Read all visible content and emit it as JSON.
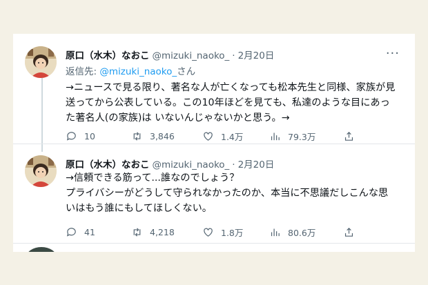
{
  "tweets": [
    {
      "name": "原口（水木）なおこ",
      "handle": "@mizuki_naoko_",
      "separator": "·",
      "date": "2月20日",
      "reply_to": {
        "prefix": "返信先: ",
        "mention": "@mizuki_naoko_",
        "suffix": "さん"
      },
      "lines": [
        "→ニュースで見る限り、著名な人が亡くなっても松本先生と同様、家族が見",
        "送ってから公表している。この10年ほどを見ても、私達のような目にあっ",
        "た著名人(の家族)は いないんじゃないかと思う。→"
      ],
      "stats": {
        "replies": "10",
        "retweets": "3,846",
        "likes": "1.4万",
        "views": "79.3万"
      }
    },
    {
      "name": "原口（水木）なおこ",
      "handle": "@mizuki_naoko_",
      "separator": "·",
      "date": "2月20日",
      "lines": [
        "→信頼できる筋って...誰なのでしょう？",
        "プライバシーがどうして守られなかったのか、本当に不思議だしこんな思",
        "いはもう誰にもしてほしくない。"
      ],
      "stats": {
        "replies": "41",
        "retweets": "4,218",
        "likes": "1.8万",
        "views": "80.6万"
      }
    }
  ],
  "more_icon": "more-dots-icon",
  "icons": [
    "reply-icon",
    "retweet-icon",
    "like-icon",
    "views-icon",
    "share-icon"
  ],
  "colors": {
    "accent": "#1d9bf0",
    "secondary_text": "#536471",
    "text": "#0f1419",
    "background": "#f4f1e6"
  }
}
